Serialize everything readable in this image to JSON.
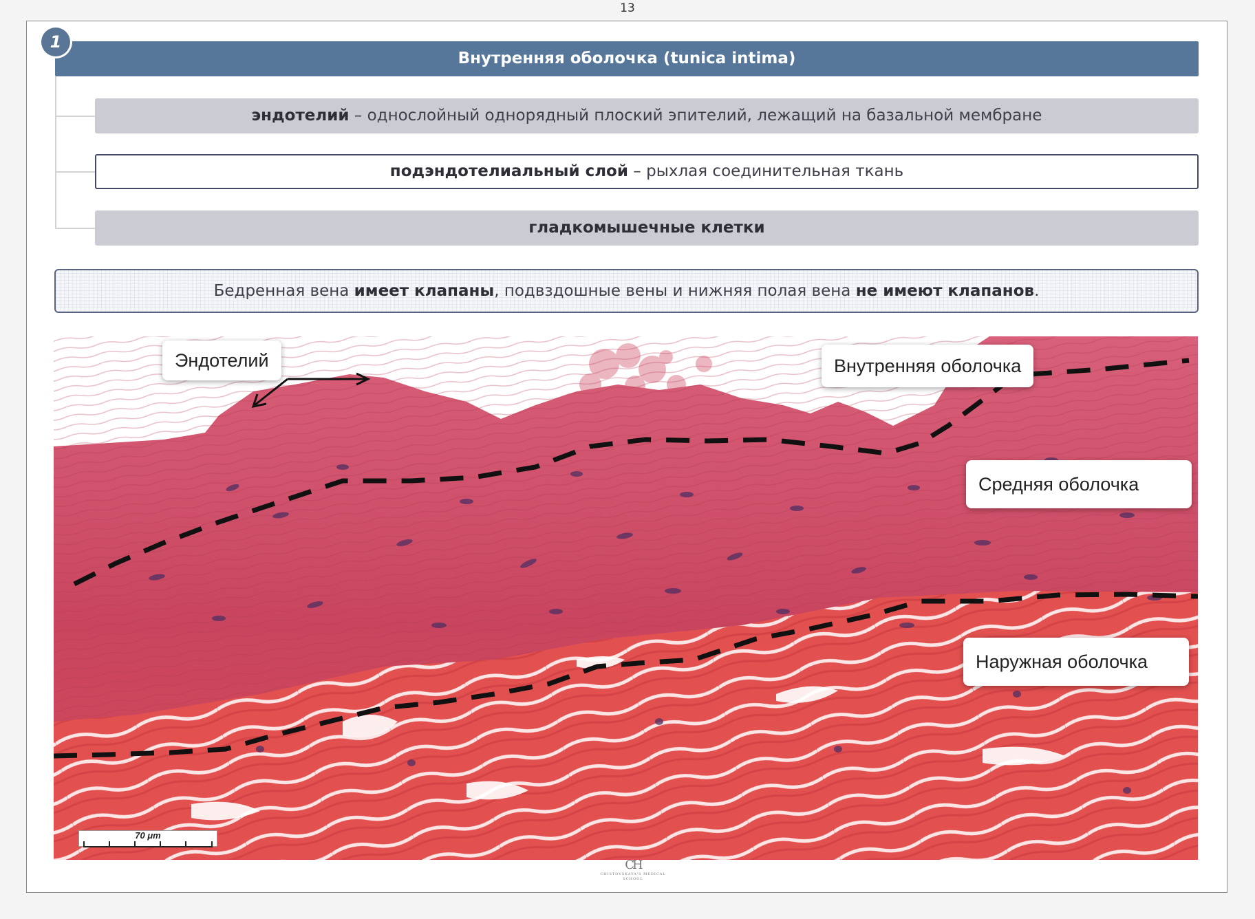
{
  "page_number": "13",
  "section": {
    "badge": "1",
    "title": "Внутренняя оболочка (tunica intima)"
  },
  "layers": [
    {
      "bold": "эндотелий",
      "rest": " – однослойный однорядный плоский эпителий, лежащий на базальной мембране"
    },
    {
      "bold": "подэндотелиальный слой",
      "rest": " – рыхлая соединительная ткань"
    },
    {
      "bold": "гладкомышечные клетки",
      "rest": ""
    }
  ],
  "note": {
    "p1": "Бедренная вена ",
    "b1": "имеет клапаны",
    "p2": ", подвздошные вены и нижняя полая вена ",
    "b2": "не имеют клапанов",
    "p3": "."
  },
  "figure": {
    "labels": {
      "endothelium": "Эндотелий",
      "intima": "Внутренняя оболочка",
      "media": "Средняя оболочка",
      "adventitia": "Наружная оболочка"
    },
    "scale_bar": "70 μm",
    "colors": {
      "tissue": "#d6506a",
      "tissue_dark": "#b8384f",
      "muscle": "#e14a4a",
      "nuclei": "#4a2d5a"
    }
  },
  "logo": {
    "mark": "CH",
    "text": "CHISTOVSKAYA'S MEDICAL SCHOOL"
  }
}
